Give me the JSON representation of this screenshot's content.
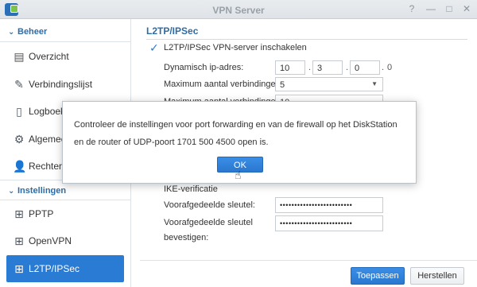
{
  "window": {
    "title": "VPN Server",
    "help_icon": "?",
    "minimize_icon": "—",
    "maximize_icon": "□",
    "close_icon": "✕"
  },
  "sidebar": {
    "section_beheer": "Beheer",
    "section_instellingen": "Instellingen",
    "items": [
      {
        "label": "Overzicht",
        "icon": "overview-icon"
      },
      {
        "label": "Verbindingslijst",
        "icon": "plug-icon"
      },
      {
        "label": "Logboek",
        "icon": "log-icon"
      },
      {
        "label": "Algemeen",
        "icon": "gear-icon"
      },
      {
        "label": "Rechten",
        "icon": "user-icon"
      },
      {
        "label": "PPTP",
        "icon": "network-icon"
      },
      {
        "label": "OpenVPN",
        "icon": "network-icon"
      },
      {
        "label": "L2TP/IPSec",
        "icon": "network-icon"
      }
    ]
  },
  "panel": {
    "title": "L2TP/IPSec",
    "enable_label": "L2TP/IPSec VPN-server inschakelen",
    "dynamic_ip_label": "Dynamisch ip-adres:",
    "ip": [
      "10",
      "3",
      "0",
      "0"
    ],
    "max_conn_label": "Maximum aantal verbindingen:",
    "max_conn_value": "5",
    "max_conn2_label": "Maximum aantal verbindingen",
    "max_conn2_value": "10",
    "ike_label": "IKE-verificatie",
    "psk_label": "Voorafgedeelde sleutel:",
    "psk_value": "•••••••••••••••••••••••••",
    "psk_confirm_label_1": "Voorafgedeelde sleutel",
    "psk_confirm_label_2": "bevestigen:",
    "psk_confirm_value": "•••••••••••••••••••••••••"
  },
  "footer": {
    "apply": "Toepassen",
    "reset": "Herstellen"
  },
  "dialog": {
    "message": "Controleer de instellingen voor port forwarding en van de firewall op het DiskStation en de router of UDP-poort 1701 500 4500 open is.",
    "ok": "OK"
  },
  "colors": {
    "accent": "#2a7bd3",
    "section_title": "#2e6ca6"
  }
}
